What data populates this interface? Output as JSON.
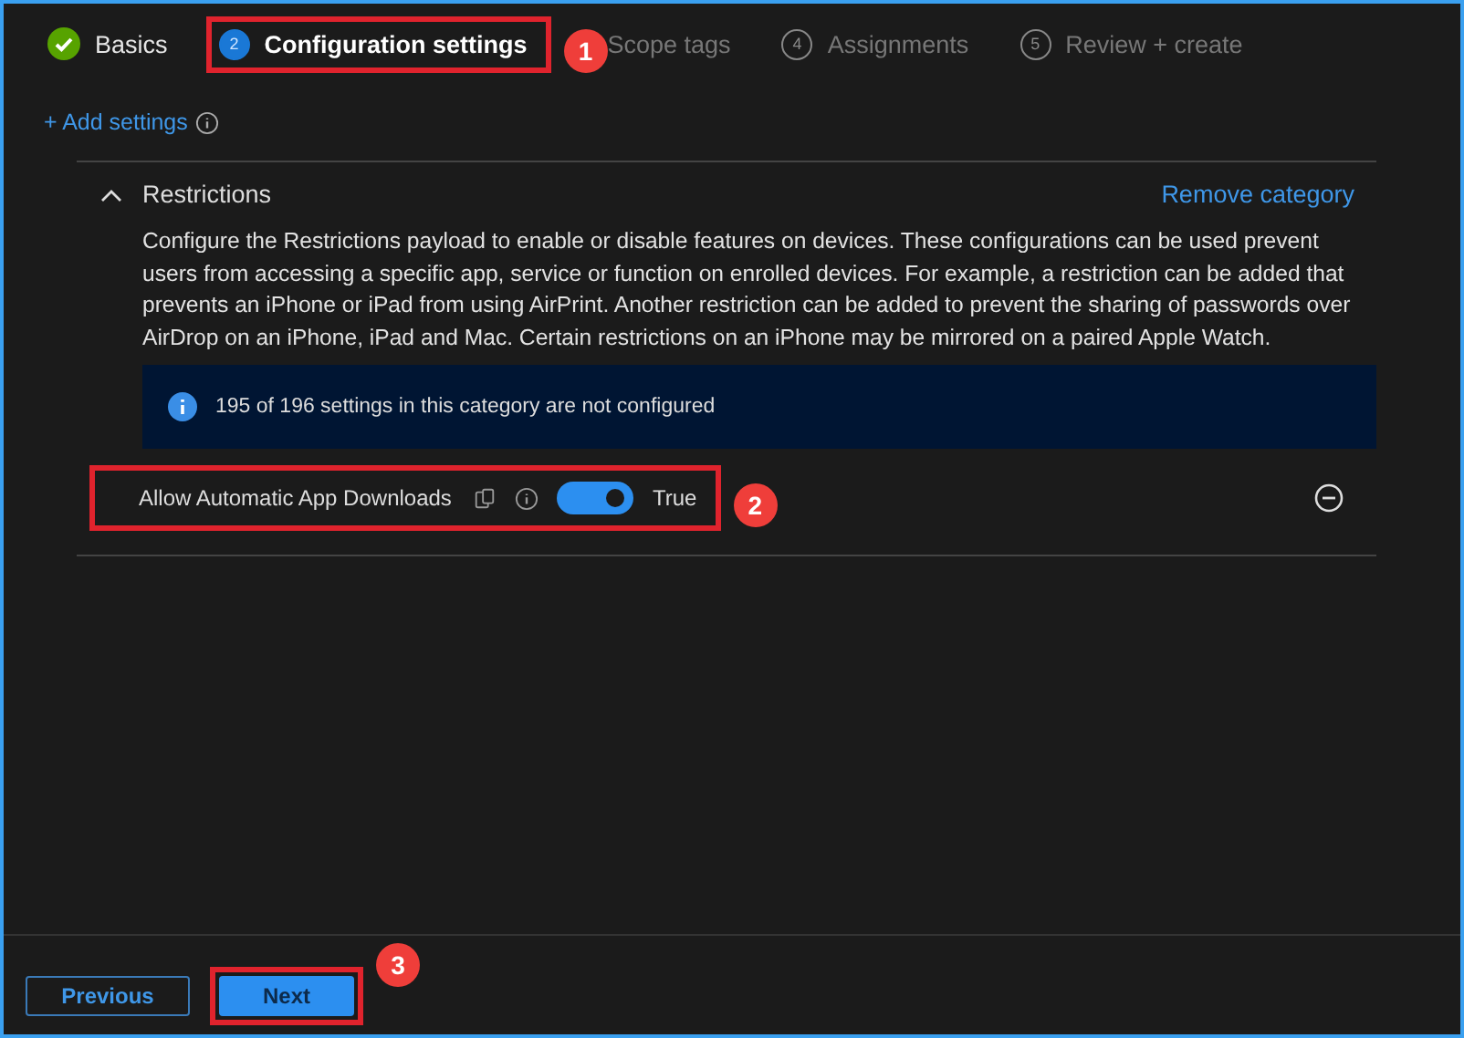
{
  "steps": [
    {
      "label": "Basics",
      "completed": true,
      "selected": false,
      "highlighted": false
    },
    {
      "number": "2",
      "label": "Configuration settings",
      "completed": false,
      "selected": true,
      "highlighted": true,
      "callout": "1"
    },
    {
      "label": "Scope tags",
      "completed": false,
      "selected": false,
      "highlighted": false
    },
    {
      "number": "4",
      "label": "Assignments",
      "completed": false,
      "selected": false,
      "highlighted": false
    },
    {
      "number": "5",
      "label": "Review + create",
      "completed": false,
      "selected": false,
      "highlighted": false
    }
  ],
  "add_settings": "+ Add settings",
  "category": {
    "title": "Restrictions",
    "expanded": true,
    "remove_link": "Remove category",
    "description": "Configure the Restrictions payload to enable or disable features on devices. These configurations can be used prevent users from accessing a specific app, service or function on enrolled devices. For example, a restriction can be added that prevents an iPhone or iPad from using AirPrint. Another restriction can be added to prevent the sharing of passwords over AirDrop on an iPhone, iPad and Mac. Certain restrictions on an iPhone may be mirrored on a paired Apple Watch.",
    "info": "195 of 196 settings in this category are not configured",
    "settings": [
      {
        "label": "Allow Automatic App Downloads",
        "on": true,
        "value": "True",
        "highlighted": true,
        "callout": "2"
      }
    ]
  },
  "buttons": [
    {
      "label": "Previous",
      "kind": "secondary",
      "highlighted": false
    },
    {
      "label": "Next",
      "kind": "primary",
      "highlighted": true,
      "callout": "3"
    }
  ]
}
